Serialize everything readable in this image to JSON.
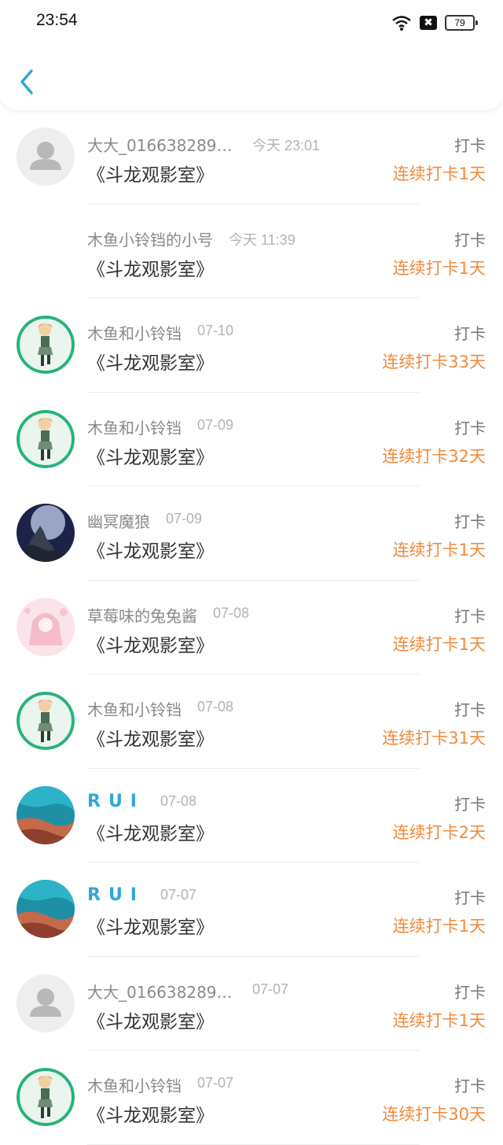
{
  "status_bar": {
    "time": "23:54",
    "battery": "79",
    "sim_status": "✖"
  },
  "header": {
    "back_icon": "chevron-left-icon",
    "accent": "#2fa6dc"
  },
  "colors": {
    "streak": "#f08a3c",
    "name": "#8a8a8a",
    "time": "#b3b3b3"
  },
  "entries": [
    {
      "name": "大大_0166382896...",
      "time": "今天 23:01",
      "title": "《斗龙观影室》",
      "action": "打卡",
      "streak": "连续打卡1天",
      "avatar": "default-avatar"
    },
    {
      "name": "木鱼小铃铛的小号",
      "time": "今天 11:39",
      "title": "《斗龙观影室》",
      "action": "打卡",
      "streak": "连续打卡1天",
      "avatar": "none"
    },
    {
      "name": "木鱼和小铃铛",
      "time": "07-10",
      "title": "《斗龙观影室》",
      "action": "打卡",
      "streak": "连续打卡33天",
      "avatar": "anime-girl"
    },
    {
      "name": "木鱼和小铃铛",
      "time": "07-09",
      "title": "《斗龙观影室》",
      "action": "打卡",
      "streak": "连续打卡32天",
      "avatar": "anime-girl"
    },
    {
      "name": "幽冥魔狼",
      "time": "07-09",
      "title": "《斗龙观影室》",
      "action": "打卡",
      "streak": "连续打卡1天",
      "avatar": "wolf-moon"
    },
    {
      "name": "草莓味的兔兔酱",
      "time": "07-08",
      "title": "《斗龙观影室》",
      "action": "打卡",
      "streak": "连续打卡1天",
      "avatar": "pink-anime"
    },
    {
      "name": "木鱼和小铃铛",
      "time": "07-08",
      "title": "《斗龙观影室》",
      "action": "打卡",
      "streak": "连续打卡31天",
      "avatar": "anime-girl"
    },
    {
      "name": "RUI",
      "time": "07-08",
      "title": "《斗龙观影室》",
      "action": "打卡",
      "streak": "连续打卡2天",
      "avatar": "beach"
    },
    {
      "name": "RUI",
      "time": "07-07",
      "title": "《斗龙观影室》",
      "action": "打卡",
      "streak": "连续打卡1天",
      "avatar": "beach"
    },
    {
      "name": "大大_0166382896...",
      "time": "07-07",
      "title": "《斗龙观影室》",
      "action": "打卡",
      "streak": "连续打卡1天",
      "avatar": "default-avatar"
    },
    {
      "name": "木鱼和小铃铛",
      "time": "07-07",
      "title": "《斗龙观影室》",
      "action": "打卡",
      "streak": "连续打卡30天",
      "avatar": "anime-girl"
    }
  ]
}
